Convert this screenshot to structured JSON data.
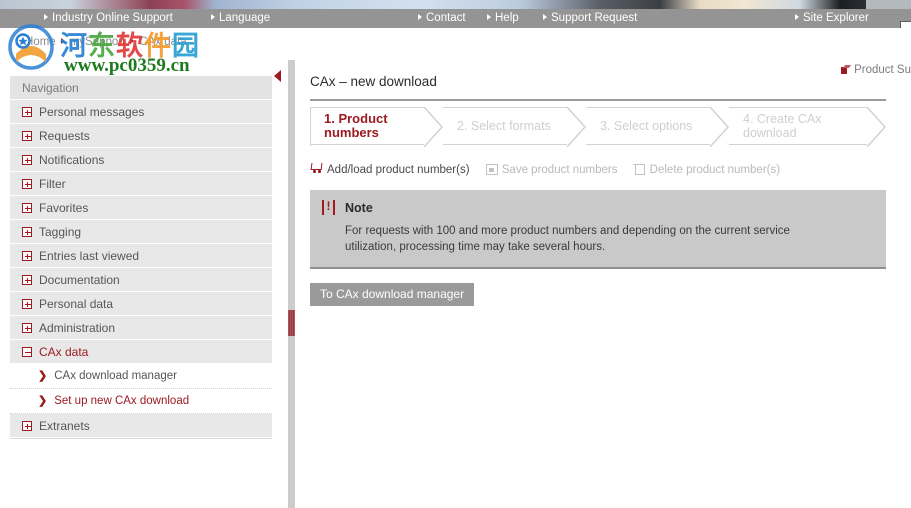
{
  "topnav": {
    "items": [
      {
        "id": "nav-ios",
        "label": "Industry Online Support"
      },
      {
        "id": "nav-lang",
        "label": "Language"
      },
      {
        "id": "nav-cont",
        "label": "Contact"
      },
      {
        "id": "nav-help",
        "label": "Help"
      },
      {
        "id": "nav-supp",
        "label": "Support Request"
      },
      {
        "id": "nav-site",
        "label": "Site Explorer"
      }
    ],
    "search_placeholder": ""
  },
  "breadcrumb": {
    "items": [
      "Home",
      "mySupport",
      "CAx data"
    ]
  },
  "product_support": {
    "label": "Product Su",
    "icon": "cube-icon"
  },
  "watermark": {
    "cn_chars": [
      "河",
      "东",
      "软",
      "件",
      "园"
    ],
    "url": "www.pc0359.cn"
  },
  "sidebar": {
    "header": "Navigation",
    "items": [
      {
        "label": "Personal messages",
        "state": "collapsed"
      },
      {
        "label": "Requests",
        "state": "collapsed"
      },
      {
        "label": "Notifications",
        "state": "collapsed"
      },
      {
        "label": "Filter",
        "state": "collapsed"
      },
      {
        "label": "Favorites",
        "state": "collapsed"
      },
      {
        "label": "Tagging",
        "state": "collapsed"
      },
      {
        "label": "Entries last viewed",
        "state": "collapsed"
      },
      {
        "label": "Documentation",
        "state": "collapsed"
      },
      {
        "label": "Personal data",
        "state": "collapsed"
      },
      {
        "label": "Administration",
        "state": "collapsed"
      },
      {
        "label": "CAx data",
        "state": "expanded"
      }
    ],
    "subitems": [
      {
        "label": "CAx download manager",
        "active": false
      },
      {
        "label": "Set up new CAx download",
        "active": true
      }
    ],
    "last_item": {
      "label": "Extranets",
      "state": "collapsed"
    }
  },
  "main": {
    "page_title": "CAx – new download",
    "steps": [
      {
        "label": "1. Product numbers",
        "current": true
      },
      {
        "label": "2. Select formats",
        "current": false
      },
      {
        "label": "3. Select options",
        "current": false
      },
      {
        "label": "4. Create CAx download",
        "current": false
      }
    ],
    "toolbar": [
      {
        "label": "Add/load product number(s)",
        "icon": "cart-icon",
        "disabled": false
      },
      {
        "label": "Save product numbers",
        "icon": "save-icon",
        "disabled": true
      },
      {
        "label": "Delete product number(s)",
        "icon": "trash-icon",
        "disabled": true
      }
    ],
    "note": {
      "icon": "exclamation-icon",
      "title": "Note",
      "body": "For requests with 100 and more product numbers and depending on the current service utilization, processing time may take several hours."
    },
    "button": {
      "label": "To CAx download manager"
    }
  },
  "colors": {
    "accent_red": "#9c1a20",
    "nav_gray": "#949494",
    "note_bg": "#c9c9c9",
    "sidebar_item_bg": "#e8e8e8",
    "button_bg": "#9a9a9a"
  }
}
